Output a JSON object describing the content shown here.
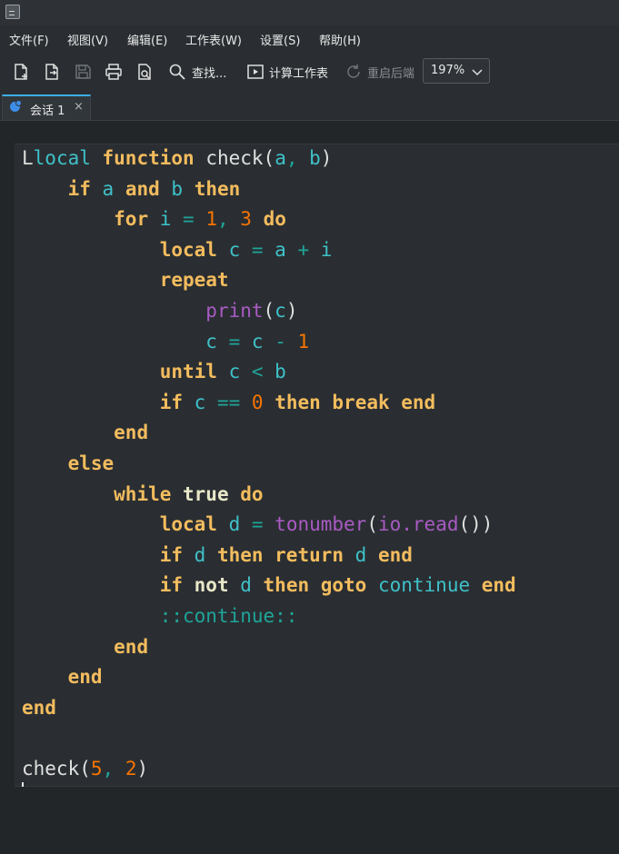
{
  "menu": [
    "文件(F)",
    "视图(V)",
    "编辑(E)",
    "工作表(W)",
    "设置(S)",
    "帮助(H)"
  ],
  "toolbar": {
    "find_label": "查找...",
    "compute_label": "计算工作表",
    "restart_label": "重启后端",
    "zoom_value": "197%",
    "icons": [
      "new-file-icon",
      "open-file-icon",
      "save-icon",
      "print-icon",
      "print-preview-icon",
      "search-icon",
      "compute-icon",
      "restart-icon",
      "chevron-down-icon"
    ]
  },
  "tab": {
    "label": "会话 1",
    "close_glyph": "×"
  },
  "code_lines": [
    [
      [
        "",
        "L"
      ],
      [
        "id",
        "local "
      ],
      [
        "kw",
        "function "
      ],
      [
        "fn",
        "check"
      ],
      [
        "par",
        "("
      ],
      [
        "id",
        "a"
      ],
      [
        "op",
        ", "
      ],
      [
        "id",
        "b"
      ],
      [
        "par",
        ")"
      ]
    ],
    [
      [
        "",
        "    "
      ],
      [
        "kw",
        "if "
      ],
      [
        "id",
        "a "
      ],
      [
        "kw",
        "and "
      ],
      [
        "id",
        "b "
      ],
      [
        "kw",
        "then"
      ]
    ],
    [
      [
        "",
        "        "
      ],
      [
        "kw",
        "for "
      ],
      [
        "id",
        "i "
      ],
      [
        "op",
        "= "
      ],
      [
        "num",
        "1"
      ],
      [
        "op",
        ", "
      ],
      [
        "num",
        "3 "
      ],
      [
        "kw",
        "do"
      ]
    ],
    [
      [
        "",
        "            "
      ],
      [
        "kw",
        "local "
      ],
      [
        "id",
        "c "
      ],
      [
        "op",
        "= "
      ],
      [
        "id",
        "a "
      ],
      [
        "op",
        "+ "
      ],
      [
        "id",
        "i"
      ]
    ],
    [
      [
        "",
        "            "
      ],
      [
        "kw",
        "repeat"
      ]
    ],
    [
      [
        "",
        "                "
      ],
      [
        "bi",
        "print"
      ],
      [
        "par",
        "("
      ],
      [
        "id",
        "c"
      ],
      [
        "par",
        ")"
      ]
    ],
    [
      [
        "",
        "                "
      ],
      [
        "id",
        "c "
      ],
      [
        "op",
        "= "
      ],
      [
        "id",
        "c "
      ],
      [
        "op",
        "- "
      ],
      [
        "num",
        "1"
      ]
    ],
    [
      [
        "",
        "            "
      ],
      [
        "kw",
        "until "
      ],
      [
        "id",
        "c "
      ],
      [
        "op",
        "< "
      ],
      [
        "id",
        "b"
      ]
    ],
    [
      [
        "",
        "            "
      ],
      [
        "kw",
        "if "
      ],
      [
        "id",
        "c "
      ],
      [
        "op",
        "== "
      ],
      [
        "num",
        "0 "
      ],
      [
        "kw",
        "then break end"
      ]
    ],
    [
      [
        "",
        "        "
      ],
      [
        "kw",
        "end"
      ]
    ],
    [
      [
        "",
        "    "
      ],
      [
        "kw",
        "else"
      ]
    ],
    [
      [
        "",
        "        "
      ],
      [
        "kw",
        "while "
      ],
      [
        "bool",
        "true "
      ],
      [
        "kw",
        "do"
      ]
    ],
    [
      [
        "",
        "            "
      ],
      [
        "kw",
        "local "
      ],
      [
        "id",
        "d "
      ],
      [
        "op",
        "= "
      ],
      [
        "bi",
        "tonumber"
      ],
      [
        "par",
        "("
      ],
      [
        "bi",
        "io.read"
      ],
      [
        "par",
        "())"
      ]
    ],
    [
      [
        "",
        "            "
      ],
      [
        "kw",
        "if "
      ],
      [
        "id",
        "d "
      ],
      [
        "kw",
        "then return "
      ],
      [
        "id",
        "d "
      ],
      [
        "kw",
        "end"
      ]
    ],
    [
      [
        "",
        "            "
      ],
      [
        "kw",
        "if "
      ],
      [
        "bool",
        "not "
      ],
      [
        "id",
        "d "
      ],
      [
        "kw",
        "then goto "
      ],
      [
        "id",
        "continue "
      ],
      [
        "kw",
        "end"
      ]
    ],
    [
      [
        "",
        "            "
      ],
      [
        "lbl",
        "::continue::"
      ]
    ],
    [
      [
        "",
        "        "
      ],
      [
        "kw",
        "end"
      ]
    ],
    [
      [
        "",
        "    "
      ],
      [
        "kw",
        "end"
      ]
    ],
    [
      [
        "kw",
        "end"
      ]
    ],
    [],
    [
      [
        "fn",
        "check"
      ],
      [
        "par",
        "("
      ],
      [
        "num",
        "5"
      ],
      [
        "op",
        ", "
      ],
      [
        "num",
        "2"
      ],
      [
        "par",
        ")"
      ]
    ]
  ],
  "colors": {
    "keyword": "#f3bc5e",
    "identifier": "#3fc1c9",
    "operator": "#1fa59a",
    "number": "#f67400",
    "builtin": "#a95ac3",
    "tab_accent": "#3daee9"
  }
}
